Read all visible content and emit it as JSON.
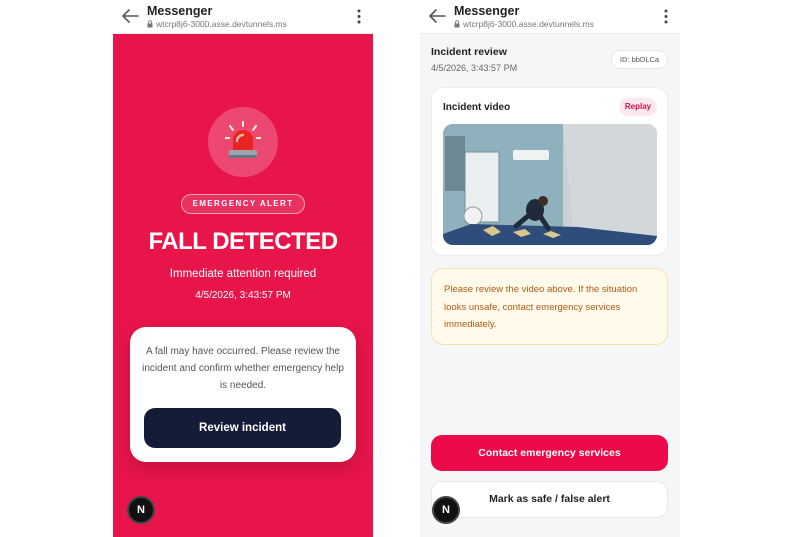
{
  "left": {
    "appbar": {
      "title": "Messenger",
      "url": "wtcrp8j6-3000.asse.devtunnels.ms"
    },
    "alert": {
      "pill": "EMERGENCY ALERT",
      "title": "FALL DETECTED",
      "subtitle": "Immediate attention required",
      "timestamp": "4/5/2026, 3:43:57 PM"
    },
    "card": {
      "message": "A fall may have occurred. Please review the incident and confirm whether emergency help is needed.",
      "button": "Review incident"
    },
    "badge": "N"
  },
  "right": {
    "appbar": {
      "title": "Messenger",
      "url": "wtcrp8j6-3000.asse.devtunnels.ms"
    },
    "header": {
      "title": "Incident review",
      "timestamp": "4/5/2026, 3:43:57 PM",
      "id": "ID: bbDLCa"
    },
    "video": {
      "label": "Incident video",
      "replay": "Replay"
    },
    "warning": "Please review the video above. If the situation looks unsafe, contact emergency services immediately.",
    "buttons": {
      "contact": "Contact emergency services",
      "safe": "Mark as safe / false alert"
    },
    "badge": "N"
  },
  "colors": {
    "alert_bg": "#e8154a",
    "primary_dark": "#141c38",
    "emergency_red": "#ec0a4a",
    "warning_text": "#b45a16",
    "warning_bg": "#fffaea"
  },
  "icons": [
    "back-arrow-icon",
    "lock-icon",
    "more-vert-icon",
    "siren-icon",
    "next-logo-icon"
  ]
}
